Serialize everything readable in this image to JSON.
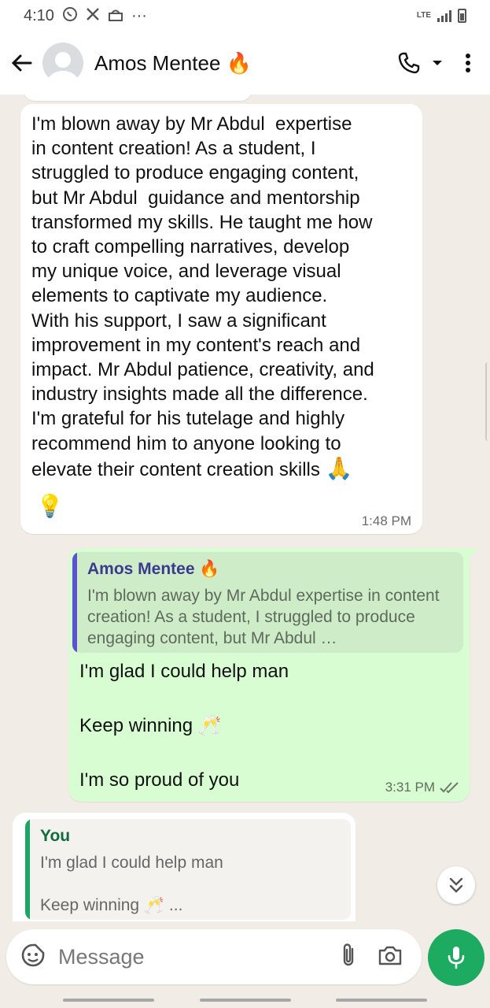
{
  "status_bar": {
    "time": "4:10",
    "network": "LTE",
    "more": "···"
  },
  "header": {
    "contact_name": "Amos Mentee 🔥"
  },
  "messages": {
    "incoming": {
      "text": "I'm blown away by Mr Abdul  expertise\nin content creation! As a student, I\nstruggled to produce engaging content,\nbut Mr Abdul  guidance and mentorship\ntransformed my skills. He taught me how\nto craft compelling narratives, develop\nmy unique voice, and leverage visual\nelements to captivate my audience.\nWith his support, I saw a significant\nimprovement in my content's reach and\nimpact. Mr Abdul patience, creativity, and\nindustry insights made all the difference.\nI'm grateful for his tutelage and highly\nrecommend him to anyone looking to\nelevate their content creation skills",
      "emoji_end": "🙏",
      "emoji_bulb": "💡",
      "time": "1:48 PM"
    },
    "outgoing": {
      "quote_author": "Amos Mentee 🔥",
      "quote_text": "I'm blown away by Mr Abdul  expertise in content creation! As a student, I struggled to produce engaging content, but Mr Abdul  …",
      "text": "I'm glad I could help man\n\nKeep winning 🥂\n\nI'm so proud of you",
      "time": "3:31 PM"
    }
  },
  "reply_preview": {
    "author": "You",
    "text": "I'm glad I could help man\n\nKeep winning 🥂 ..."
  },
  "input": {
    "placeholder": "Message"
  },
  "colors": {
    "outgoing_bubble": "#d8fdd2",
    "mic_button": "#1daa61",
    "quote_bar": "#5b53d0",
    "reply_bar": "#1da563"
  },
  "icons": [
    "back-arrow-icon",
    "avatar-icon",
    "phone-icon",
    "dropdown-icon",
    "more-vert-icon",
    "sticker-icon",
    "attach-icon",
    "camera-icon",
    "mic-icon",
    "chevron-double-down-icon",
    "double-check-icon",
    "whatsapp-icon",
    "x-icon",
    "mosque-icon"
  ]
}
